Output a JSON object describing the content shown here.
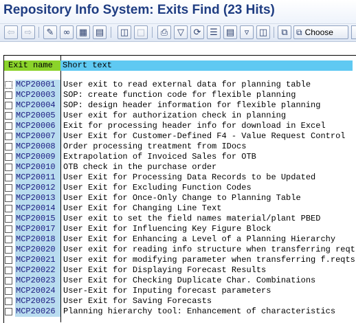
{
  "window": {
    "title": "Repository Info System: Exits Find (23 Hits)"
  },
  "toolbar": {
    "choose_label": "Choose"
  },
  "table": {
    "col_exit_name": "Exit name",
    "col_short_text": "Short text",
    "rows": [
      {
        "code": "MCP20001",
        "text": "User exit to read external data for planning table"
      },
      {
        "code": "MCP20003",
        "text": "SOP: create function code for flexible planning"
      },
      {
        "code": "MCP20004",
        "text": "SOP: design header information for flexible planning"
      },
      {
        "code": "MCP20005",
        "text": "User exit for authorization check in planning"
      },
      {
        "code": "MCP20006",
        "text": "Exit for processing header info for download in Excel"
      },
      {
        "code": "MCP20007",
        "text": "User Exit for Customer-Defined F4 - Value Request Control"
      },
      {
        "code": "MCP20008",
        "text": "Order processing treatment from IDocs"
      },
      {
        "code": "MCP20009",
        "text": "Extrapolation of Invoiced Sales for OTB"
      },
      {
        "code": "MCP20010",
        "text": "OTB check in the purchase order"
      },
      {
        "code": "MCP20011",
        "text": "User Exit for Processing Data Records to be Updated"
      },
      {
        "code": "MCP20012",
        "text": "User Exit for Excluding Function Codes"
      },
      {
        "code": "MCP20013",
        "text": "User Exit for Once-Only Change to Planning Table"
      },
      {
        "code": "MCP20014",
        "text": "User Exit for Changing Line Text"
      },
      {
        "code": "MCP20015",
        "text": "User exit to set the field names material/plant PBED"
      },
      {
        "code": "MCP20017",
        "text": "User Exit for Influencing Key Figure Block"
      },
      {
        "code": "MCP20018",
        "text": "User Exit for Enhancing a Level of a Planning Hierarchy"
      },
      {
        "code": "MCP20020",
        "text": "User exit for reading info structure when transferring reqts"
      },
      {
        "code": "MCP20021",
        "text": "User exit for modifying parameter when transferring f.reqts"
      },
      {
        "code": "MCP20022",
        "text": "User Exit for Displaying Forecast Results"
      },
      {
        "code": "MCP20023",
        "text": "User Exit for Checking Duplicate Char. Combinations"
      },
      {
        "code": "MCP20024",
        "text": "User-Exit for Inputing forecast parameters"
      },
      {
        "code": "MCP20025",
        "text": "User Exit for Saving Forecasts"
      },
      {
        "code": "MCP20026",
        "text": "Planning hierarchy tool: Enhancement of characteristics"
      }
    ]
  },
  "icons": {
    "back": "arrow-left-icon",
    "forward": "arrow-right-icon",
    "edit": "pencil-icon",
    "where_used": "glasses-icon",
    "hierarchy": "hierarchy-icon",
    "tree": "tree-icon",
    "display": "display-icon",
    "print": "printer-icon",
    "filter": "filter-icon",
    "refresh": "refresh-icon",
    "choose": "choose-icon"
  }
}
